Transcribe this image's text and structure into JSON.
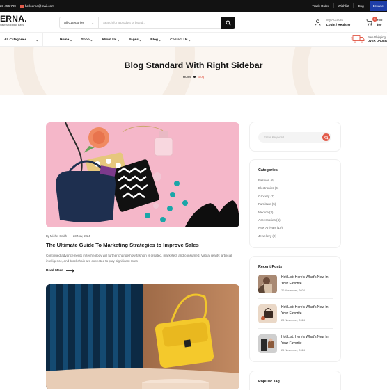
{
  "topbar": {
    "phone": "23 456 789",
    "email": "helloerna@mail.com",
    "links": [
      "Track Order",
      "Wishlist",
      "Eng"
    ],
    "browse_button": "Browse"
  },
  "header": {
    "logo": "ERNA.",
    "tagline": "New Shopping Easy",
    "search": {
      "category": "All Categories",
      "placeholder": "Search for a product or brand..."
    },
    "account": {
      "line1": "My Account",
      "line2": "Login / Register"
    },
    "cart": {
      "badge": "0",
      "line1": "Your",
      "line2": "$00"
    }
  },
  "nav": {
    "all_categories": "All Categories",
    "items": [
      "Home",
      "Shop",
      "About Us",
      "Pages",
      "Blog",
      "Contact Us"
    ],
    "shipping": {
      "line1": "Free Shipping",
      "line2": "OVER ORDER"
    }
  },
  "hero": {
    "title": "Blog Standard With Right Sidebar",
    "breadcrumb": {
      "home": "Home",
      "current": "Blog"
    }
  },
  "posts": [
    {
      "author": "By Michel Smith",
      "date": "23 Nov, 2024",
      "title": "The Ultimate Guide To Marketing Strategies to Improve Sales",
      "excerpt": "Continued advancements in technology will further change how fashion is created, marketed, and consumed. Virtual reality, artificial intelligence, and blockchain are expected to play significant roles",
      "read_more": "Read More"
    }
  ],
  "sidebar": {
    "search_placeholder": "Enter Keyword",
    "categories_title": "Categories",
    "categories": [
      "Fashion (6)",
      "Electronics (4)",
      "Grocery (7)",
      "Furniture (5)",
      "Medical(3)",
      "Accessories (6)",
      "New Arrivals (10)",
      "Jewellery (2)"
    ],
    "recent_title": "Recent Posts",
    "recent_posts": [
      {
        "title": "Hot List: Here's What's New In Your Favorite",
        "date": "20 November, 2024"
      },
      {
        "title": "Hot List: Here's What's New In Your Favorite",
        "date": "23 November, 2024"
      },
      {
        "title": "Hot List: Here's What's New In Your Favorite",
        "date": "25 November, 2024"
      }
    ],
    "tags_title": "Popular Tag"
  },
  "colors": {
    "accent": "#e25b4a",
    "dark": "#121212",
    "hero_bg": "#fbf6f1",
    "browse_blue": "#1f3ea8"
  }
}
